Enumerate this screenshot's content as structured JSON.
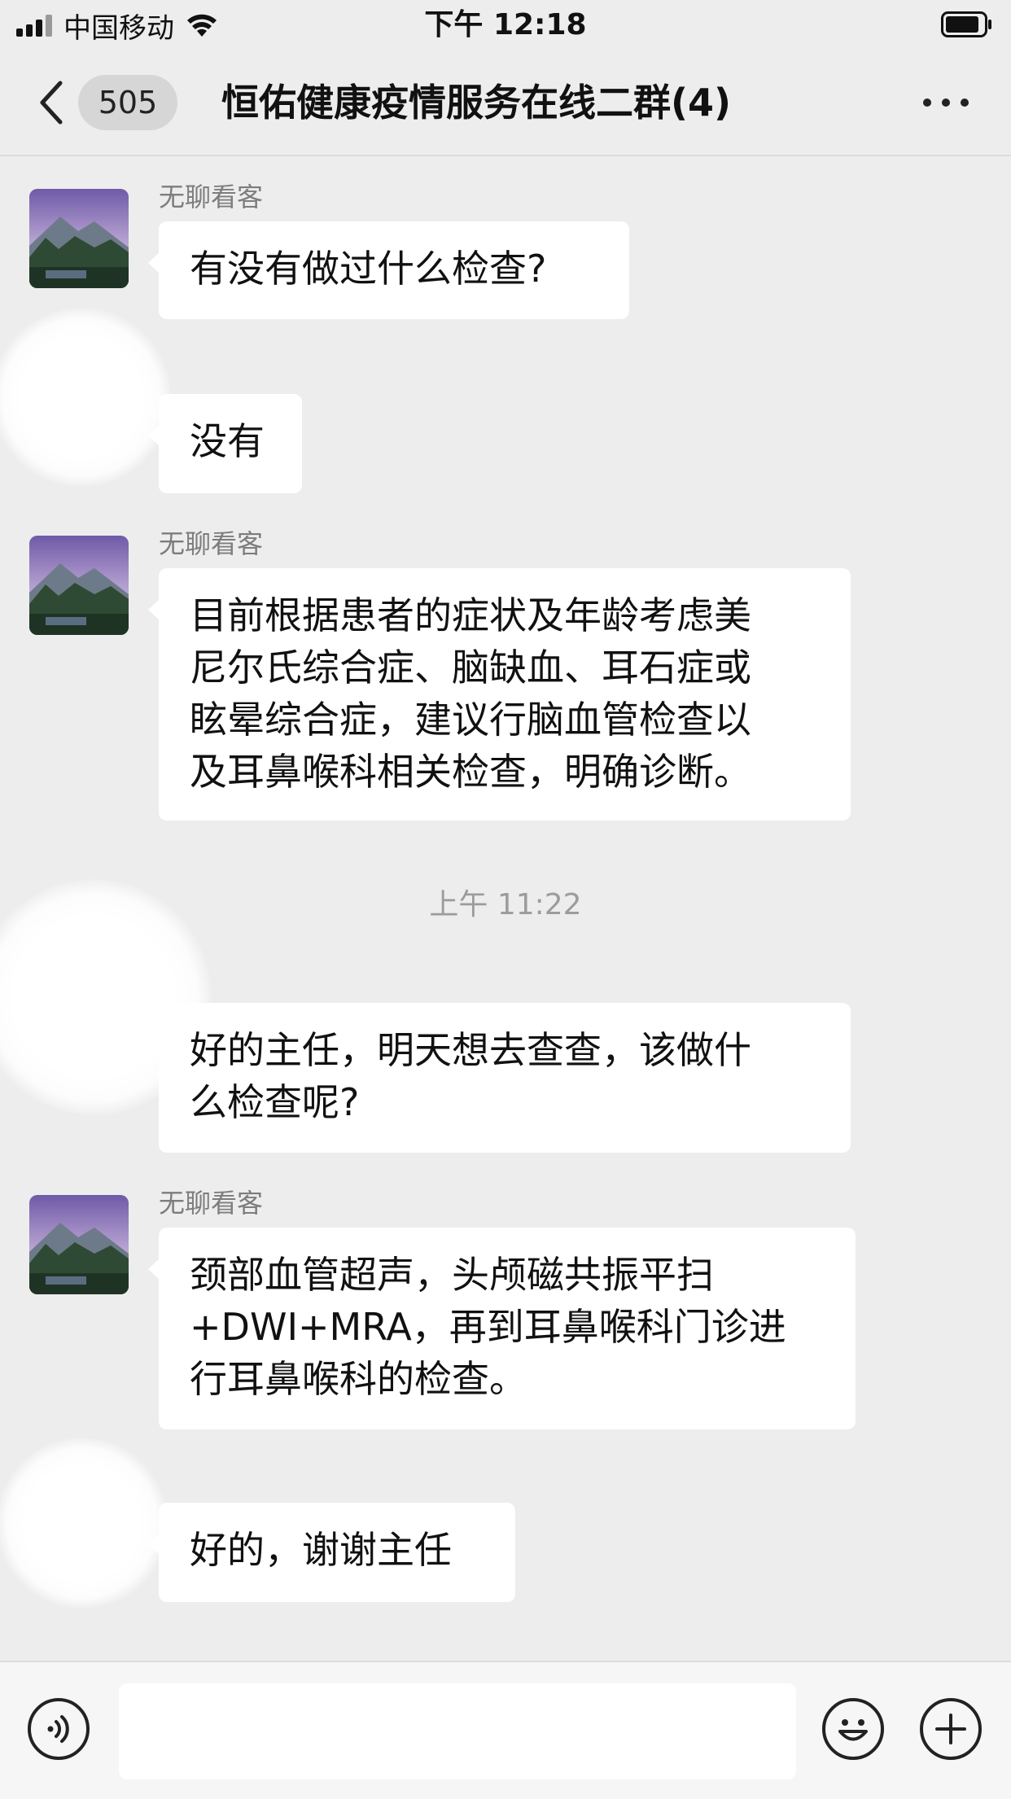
{
  "status_bar": {
    "carrier": "中国移动",
    "time": "下午 12:18"
  },
  "nav": {
    "unread_count": "505",
    "title": "恒佑健康疫情服务在线二群(4)"
  },
  "messages": [
    {
      "sender": "无聊看客",
      "text": "有没有做过什么检查?"
    },
    {
      "sender": "",
      "text": "没有"
    },
    {
      "sender": "无聊看客",
      "text": "目前根据患者的症状及年龄考虑美\n尼尔氏综合症、脑缺血、耳石症或\n眩晕综合症，建议行脑血管检查以\n及耳鼻喉科相关检查，明确诊断。"
    },
    {
      "sender": "",
      "text": "好的主任，明天想去查查，该做什\n么检查呢?"
    },
    {
      "sender": "无聊看客",
      "text": "颈部血管超声，头颅磁共振平扫\n+DWI+MRA，再到耳鼻喉科门诊进\n行耳鼻喉科的检查。"
    },
    {
      "sender": "",
      "text": "好的，谢谢主任"
    }
  ],
  "timestamp": "上午 11:22",
  "input": {
    "value": ""
  },
  "icons": {
    "back": "chevron-left-icon",
    "more": "ellipsis-icon",
    "voice": "voice-icon",
    "emoji": "emoji-icon",
    "plus": "plus-icon"
  }
}
